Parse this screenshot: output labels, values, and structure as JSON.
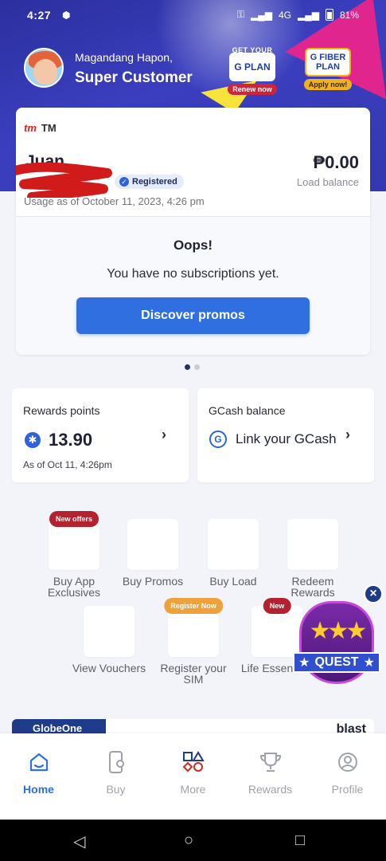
{
  "status_bar": {
    "time": "4:27",
    "network": "4G",
    "battery": "81%"
  },
  "header": {
    "greeting": "Magandang Hapon,",
    "user_name": "Super Customer",
    "plan_g": {
      "caption": "GET YOUR",
      "logo": "G PLAN",
      "cta": "Renew now"
    },
    "plan_fiber": {
      "logo": "G FIBER PLAN",
      "cta": "Apply now!"
    }
  },
  "account_card": {
    "brand": "TM",
    "brand_logo": "tm",
    "name": "Juan",
    "status": "Registered",
    "usage_as_of": "Usage as of October 11, 2023, 4:26 pm",
    "load_balance": "₱0.00",
    "load_balance_label": "Load balance",
    "empty_title": "Oops!",
    "empty_message": "You have no subscriptions yet.",
    "cta": "Discover promos"
  },
  "carousel": {
    "pages": 2,
    "active": 1
  },
  "rewards": {
    "title": "Rewards points",
    "value": "13.90",
    "as_of": "As of Oct 11, 4:26pm"
  },
  "gcash": {
    "title": "GCash balance",
    "link_text": "Link your GCash"
  },
  "quick_actions": {
    "buy_app_exclusives": {
      "label": "Buy App Exclusives",
      "badge": "New offers"
    },
    "buy_promos": {
      "label": "Buy Promos"
    },
    "buy_load": {
      "label": "Buy Load"
    },
    "redeem_rewards": {
      "label": "Redeem Rewards"
    },
    "view_vouchers": {
      "label": "View Vouchers"
    },
    "register_sim": {
      "label": "Register your SIM",
      "badge": "Register Now"
    },
    "life_essentials": {
      "label": "Life Essentials",
      "badge": "New"
    }
  },
  "quest": {
    "label": "QUEST"
  },
  "banner": {
    "left": "GlobeOne",
    "right": "blast"
  },
  "bottom_nav": [
    {
      "label": "Home",
      "icon": "home-icon"
    },
    {
      "label": "Buy",
      "icon": "phone-icon"
    },
    {
      "label": "More",
      "icon": "shapes-icon"
    },
    {
      "label": "Rewards",
      "icon": "trophy-icon"
    },
    {
      "label": "Profile",
      "icon": "profile-icon"
    }
  ],
  "colors": {
    "header_blue": "#3338b0",
    "primary_blue": "#2f6fe0",
    "badge_red": "#b3222e",
    "badge_orange": "#f0a23a"
  }
}
